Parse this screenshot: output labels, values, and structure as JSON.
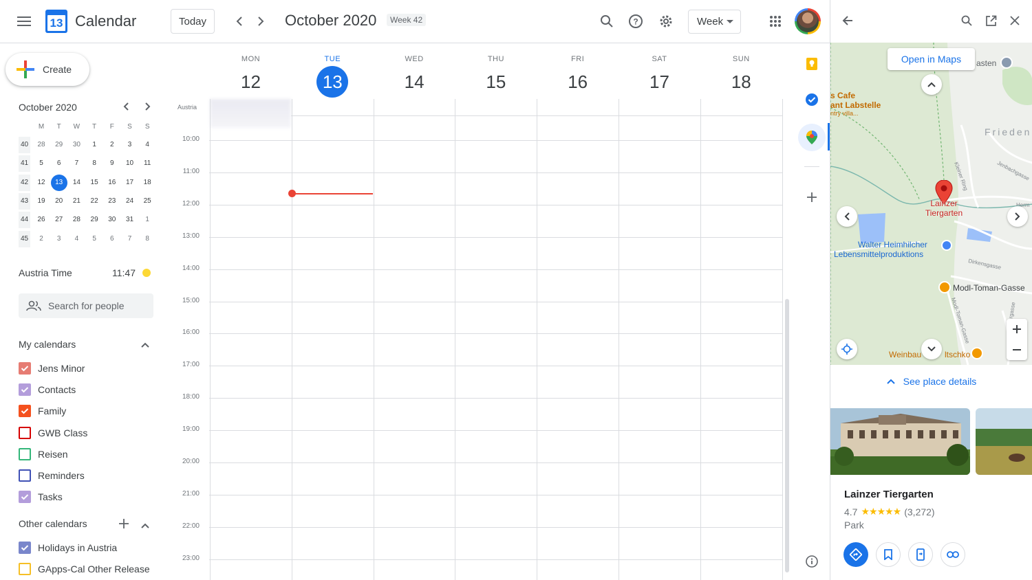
{
  "app": {
    "title": "Calendar",
    "logo_day": "13"
  },
  "toolbar": {
    "today": "Today",
    "month_title": "October 2020",
    "week_badge": "Week 42",
    "view_select": "Week"
  },
  "sidebar": {
    "create": "Create",
    "mini": {
      "title": "October 2020",
      "headers": [
        "M",
        "T",
        "W",
        "T",
        "F",
        "S",
        "S"
      ],
      "rows": [
        {
          "week": "40",
          "days": [
            "28",
            "29",
            "30",
            "1",
            "2",
            "3",
            "4"
          ]
        },
        {
          "week": "41",
          "days": [
            "5",
            "6",
            "7",
            "8",
            "9",
            "10",
            "11"
          ]
        },
        {
          "week": "42",
          "days": [
            "12",
            "13",
            "14",
            "15",
            "16",
            "17",
            "18"
          ]
        },
        {
          "week": "43",
          "days": [
            "19",
            "20",
            "21",
            "22",
            "23",
            "24",
            "25"
          ]
        },
        {
          "week": "44",
          "days": [
            "26",
            "27",
            "28",
            "29",
            "30",
            "31",
            "1"
          ]
        },
        {
          "week": "45",
          "days": [
            "2",
            "3",
            "4",
            "5",
            "6",
            "7",
            "8"
          ]
        }
      ]
    },
    "time_label": "Austria Time",
    "time_value": "11:47",
    "search_placeholder": "Search for people",
    "my_calendars_title": "My calendars",
    "my_calendars": [
      {
        "name": "Jens Minor",
        "color": "#e67c73",
        "checked": true
      },
      {
        "name": "Contacts",
        "color": "#b39ddb",
        "checked": true
      },
      {
        "name": "Family",
        "color": "#f4511e",
        "checked": true
      },
      {
        "name": "GWB Class",
        "color": "#d50000",
        "checked": false
      },
      {
        "name": "Reisen",
        "color": "#33b679",
        "checked": false
      },
      {
        "name": "Reminders",
        "color": "#3f51b5",
        "checked": false
      },
      {
        "name": "Tasks",
        "color": "#b39ddb",
        "checked": true
      }
    ],
    "other_calendars_title": "Other calendars",
    "other_calendars": [
      {
        "name": "Holidays in Austria",
        "color": "#7986cb",
        "checked": true
      },
      {
        "name": "GApps-Cal Other Release",
        "color": "#f6bf26",
        "checked": false
      }
    ]
  },
  "week": {
    "days": [
      {
        "name": "MON",
        "num": "12",
        "today": false
      },
      {
        "name": "TUE",
        "num": "13",
        "today": true
      },
      {
        "name": "WED",
        "num": "14",
        "today": false
      },
      {
        "name": "THU",
        "num": "15",
        "today": false
      },
      {
        "name": "FRI",
        "num": "16",
        "today": false
      },
      {
        "name": "SAT",
        "num": "17",
        "today": false
      },
      {
        "name": "SUN",
        "num": "18",
        "today": false
      }
    ],
    "timezone": "Austria",
    "hours": [
      "10:00",
      "11:00",
      "12:00",
      "13:00",
      "14:00",
      "15:00",
      "16:00",
      "17:00",
      "18:00",
      "19:00",
      "20:00",
      "21:00",
      "22:00",
      "23:00"
    ]
  },
  "panel": {
    "open_in_maps": "Open in Maps",
    "map_labels": {
      "cafe1": "s Cafe",
      "cafe2": "ant Labstelle",
      "cafe3": "ntry villa...",
      "asten": "asten",
      "frieden": "Frieden",
      "jenbach": "Jenbachgasse",
      "kleiner": "Kleiner Ring",
      "place1": "Lainzer",
      "place2": "Tiergarten",
      "walter1": "Walter Heimhilcher",
      "walter2": "Lebensmittelproduktions",
      "dirken": "Dirkensgasse",
      "modl": "Modl-Toman-Gasse",
      "modl_v": "Modl-Toman-Gasse",
      "weinbau": "Weinbau",
      "weinbau2": "ltschko",
      "herm": "Herm",
      "argasse": "rgasse"
    },
    "see_details": "See place details",
    "place_name": "Lainzer Tiergarten",
    "rating": "4.7",
    "stars": "★★★★★",
    "reviews": "(3,272)",
    "category": "Park"
  }
}
